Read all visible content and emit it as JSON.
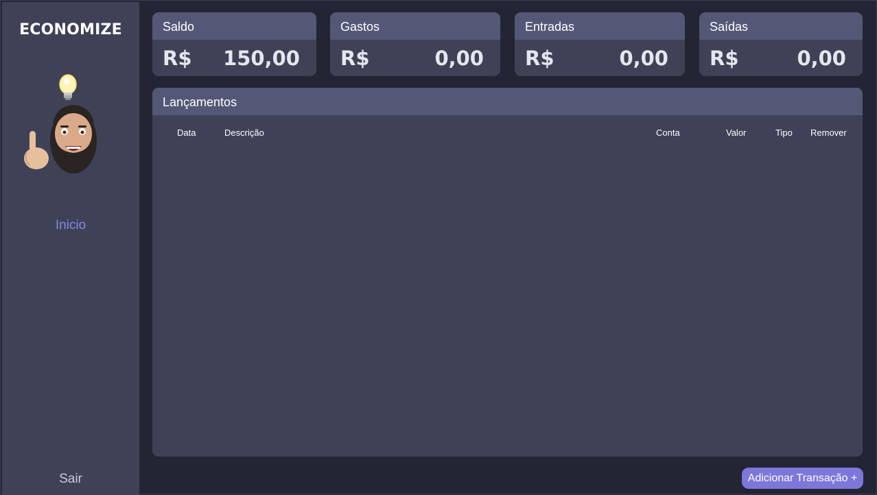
{
  "app": {
    "brand": "ECONOMIZE"
  },
  "sidebar": {
    "nav_inicio": "Inicio",
    "nav_sair": "Sair",
    "avatar_icon": "memoji-idea-icon"
  },
  "cards": [
    {
      "title": "Saldo",
      "currency": "R$",
      "value": "150,00"
    },
    {
      "title": "Gastos",
      "currency": "R$",
      "value": "0,00"
    },
    {
      "title": "Entradas",
      "currency": "R$",
      "value": "0,00"
    },
    {
      "title": "Saídas",
      "currency": "R$",
      "value": "0,00"
    }
  ],
  "table": {
    "title": "Lançamentos",
    "columns": [
      "Data",
      "Descrição",
      "Conta",
      "Valor",
      "Tipo",
      "Remover"
    ],
    "rows": []
  },
  "actions": {
    "add_transaction": "Adicionar Transação +"
  },
  "colors": {
    "accent": "#7c77d9",
    "nav_active": "#8a84e6",
    "panel": "#3f4257",
    "panel_header": "#545775",
    "background": "#232535"
  }
}
